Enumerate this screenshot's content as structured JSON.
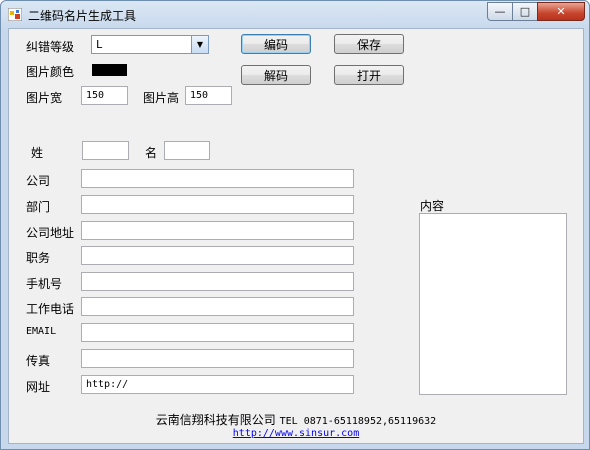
{
  "window": {
    "title": "二维码名片生成工具",
    "controls": {
      "minimize": "—",
      "maximize": "□",
      "close": "✕"
    }
  },
  "settings": {
    "error_level_label": "纠错等级",
    "error_level_value": "L",
    "color_label": "图片颜色",
    "color_value": "#000000",
    "width_label": "图片宽",
    "width_value": "150",
    "height_label": "图片高",
    "height_value": "150"
  },
  "buttons": {
    "encode": "编码",
    "decode": "解码",
    "save": "保存",
    "open": "打开"
  },
  "form": {
    "surname_label": "姓",
    "surname_value": "",
    "given_name_label": "名",
    "given_name_value": "",
    "fields": [
      {
        "label": "公司",
        "value": ""
      },
      {
        "label": "部门",
        "value": ""
      },
      {
        "label": "公司地址",
        "value": ""
      },
      {
        "label": "职务",
        "value": ""
      },
      {
        "label": "手机号",
        "value": ""
      },
      {
        "label": "工作电话",
        "value": ""
      },
      {
        "label": "EMAIL",
        "value": ""
      },
      {
        "label": "传真",
        "value": ""
      },
      {
        "label": "网址",
        "value": "http://"
      }
    ]
  },
  "content": {
    "label": "内容",
    "value": ""
  },
  "footer": {
    "company": "云南信翔科技有限公司",
    "tel": "TEL 0871-65118952,65119632",
    "link": "http://www.sinsur.com"
  }
}
